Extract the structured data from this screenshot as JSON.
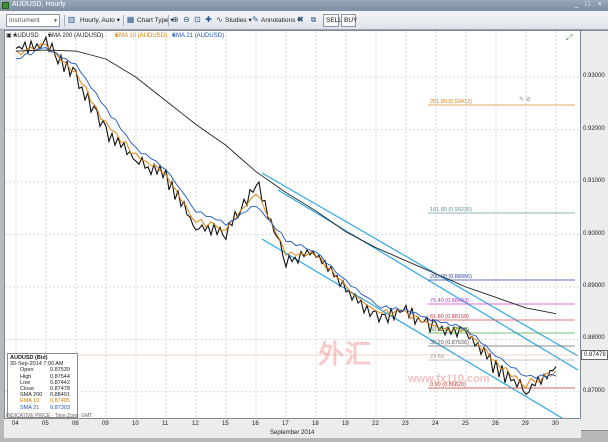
{
  "window": {
    "title": "AUDUSD, Hourly"
  },
  "toolbar": {
    "instrument_placeholder": "Instrument",
    "timeframe": "Hourly, Auto",
    "chart_type": "Chart Type",
    "studies": "Studies",
    "annotations": "Annotations",
    "sell": "SELL",
    "buy": "BUY",
    "icons": [
      "zoom-in-icon",
      "zoom-out-icon",
      "fit-icon",
      "crosshair-icon",
      "studies-icon",
      "annotations-icon",
      "close-icon",
      "link-icon"
    ]
  },
  "legend": {
    "symbol": "AUDUSD",
    "sma200": "SMA 200 (AUDUSD)",
    "ema10": "EMA 10 (AUDUSD)",
    "sma21": "SMA 21 (AUDUSD)"
  },
  "yaxis": {
    "ticks": [
      "0.93000",
      "0.92000",
      "0.91000",
      "0.90000",
      "0.89000",
      "0.88000",
      "0.87000"
    ],
    "current_price": "0.87478"
  },
  "xaxis": {
    "ticks": [
      "04",
      "05",
      "08",
      "09",
      "10",
      "11",
      "12",
      "15",
      "16",
      "17",
      "18",
      "19",
      "22",
      "23",
      "24",
      "25",
      "26",
      "29",
      "30"
    ],
    "title": "September 2014"
  },
  "fib_labels": [
    "261.80 (0.92412)",
    "161.80 (0.90235)",
    "200.00 (0.88956)",
    "76.40 (0.88493)",
    "61.80 (0.88169)",
    "50.00 (0.87908)",
    "38.20 (0.87636)",
    "23.60",
    "0.00 (0.86820)"
  ],
  "databox": {
    "title": "AUDUSD (Bid)",
    "datetime": "30-Sep-2014 7:00 AM",
    "rows": [
      {
        "label": "Open",
        "value": "0.87539"
      },
      {
        "label": "High",
        "value": "0.87544"
      },
      {
        "label": "Low",
        "value": "0.87442"
      },
      {
        "label": "Close",
        "value": "0.87478"
      },
      {
        "label": "SMA 200",
        "value": "0.88491"
      },
      {
        "label": "EMA 10",
        "value": "0.87405"
      },
      {
        "label": "SMA 21",
        "value": "0.87303"
      }
    ]
  },
  "footer": "INDICATIVE PRICE · Time Zone: GMT",
  "watermark": {
    "main": "外汇",
    "url": "www.fx110.com"
  },
  "colors": {
    "sma200": "#222222",
    "ema10": "#e07b00",
    "sma21": "#1f55b8",
    "channel": "#2ea8e6",
    "price": "#111111"
  },
  "chart_data": {
    "type": "line",
    "title": "AUDUSD, Hourly",
    "xlabel": "September 2014",
    "ylabel": "",
    "ylim": [
      0.865,
      0.9375
    ],
    "x": [
      "04",
      "05",
      "08",
      "09",
      "10",
      "11",
      "12",
      "15",
      "16",
      "17",
      "18",
      "19",
      "22",
      "23",
      "24",
      "25",
      "26",
      "29",
      "30"
    ],
    "series": [
      {
        "name": "AUDUSD",
        "values": [
          0.9355,
          0.9365,
          0.93,
          0.9195,
          0.914,
          0.911,
          0.901,
          0.9005,
          0.91,
          0.895,
          0.8965,
          0.8895,
          0.884,
          0.8855,
          0.882,
          0.881,
          0.8745,
          0.87,
          0.8748
        ]
      },
      {
        "name": "EMA 10 (AUDUSD)",
        "values": [
          0.9345,
          0.936,
          0.931,
          0.921,
          0.915,
          0.9115,
          0.9025,
          0.901,
          0.908,
          0.8965,
          0.896,
          0.89,
          0.885,
          0.885,
          0.8825,
          0.8815,
          0.8755,
          0.8715,
          0.874
        ]
      },
      {
        "name": "SMA 21 (AUDUSD)",
        "values": [
          0.9335,
          0.9355,
          0.9325,
          0.924,
          0.9165,
          0.9125,
          0.9045,
          0.902,
          0.9055,
          0.899,
          0.8965,
          0.891,
          0.8865,
          0.8855,
          0.8835,
          0.882,
          0.877,
          0.873,
          0.873
        ]
      },
      {
        "name": "SMA 200 (AUDUSD)",
        "values": [
          0.935,
          0.9352,
          0.935,
          0.9335,
          0.93,
          0.9255,
          0.921,
          0.917,
          0.912,
          0.908,
          0.9045,
          0.9005,
          0.8975,
          0.895,
          0.8925,
          0.89,
          0.888,
          0.886,
          0.8849
        ]
      }
    ]
  }
}
